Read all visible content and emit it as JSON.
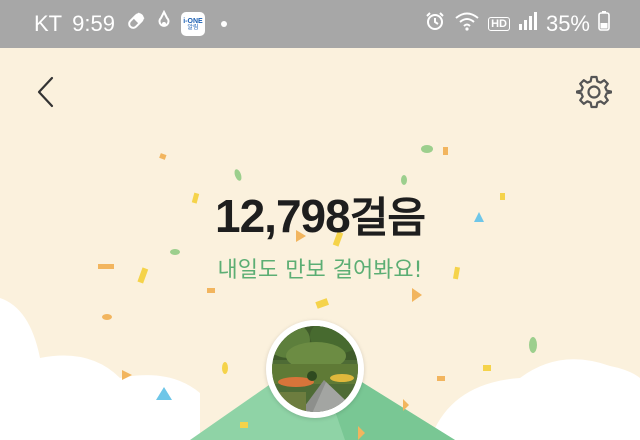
{
  "status_bar": {
    "carrier": "KT",
    "time": "9:59",
    "app_badge_line1": "i-ONE",
    "app_badge_line2": "알림",
    "hd_label": "HD",
    "battery": "35%"
  },
  "steps": {
    "count": "12,798",
    "unit": "걸음"
  },
  "message": "내일도 만보 걸어봐요!",
  "icons": {
    "back": "chevron-left-icon",
    "settings": "gear-icon",
    "pill": "pill-icon",
    "notification": "drop-icon",
    "alarm": "alarm-icon",
    "wifi": "wifi-icon",
    "signal": "signal-icon",
    "battery": "battery-icon"
  },
  "colors": {
    "background": "#fbf1dd",
    "status_bar": "#a7a7a7",
    "message_green": "#5cae74",
    "mountain_green": "#8fd3a6"
  }
}
